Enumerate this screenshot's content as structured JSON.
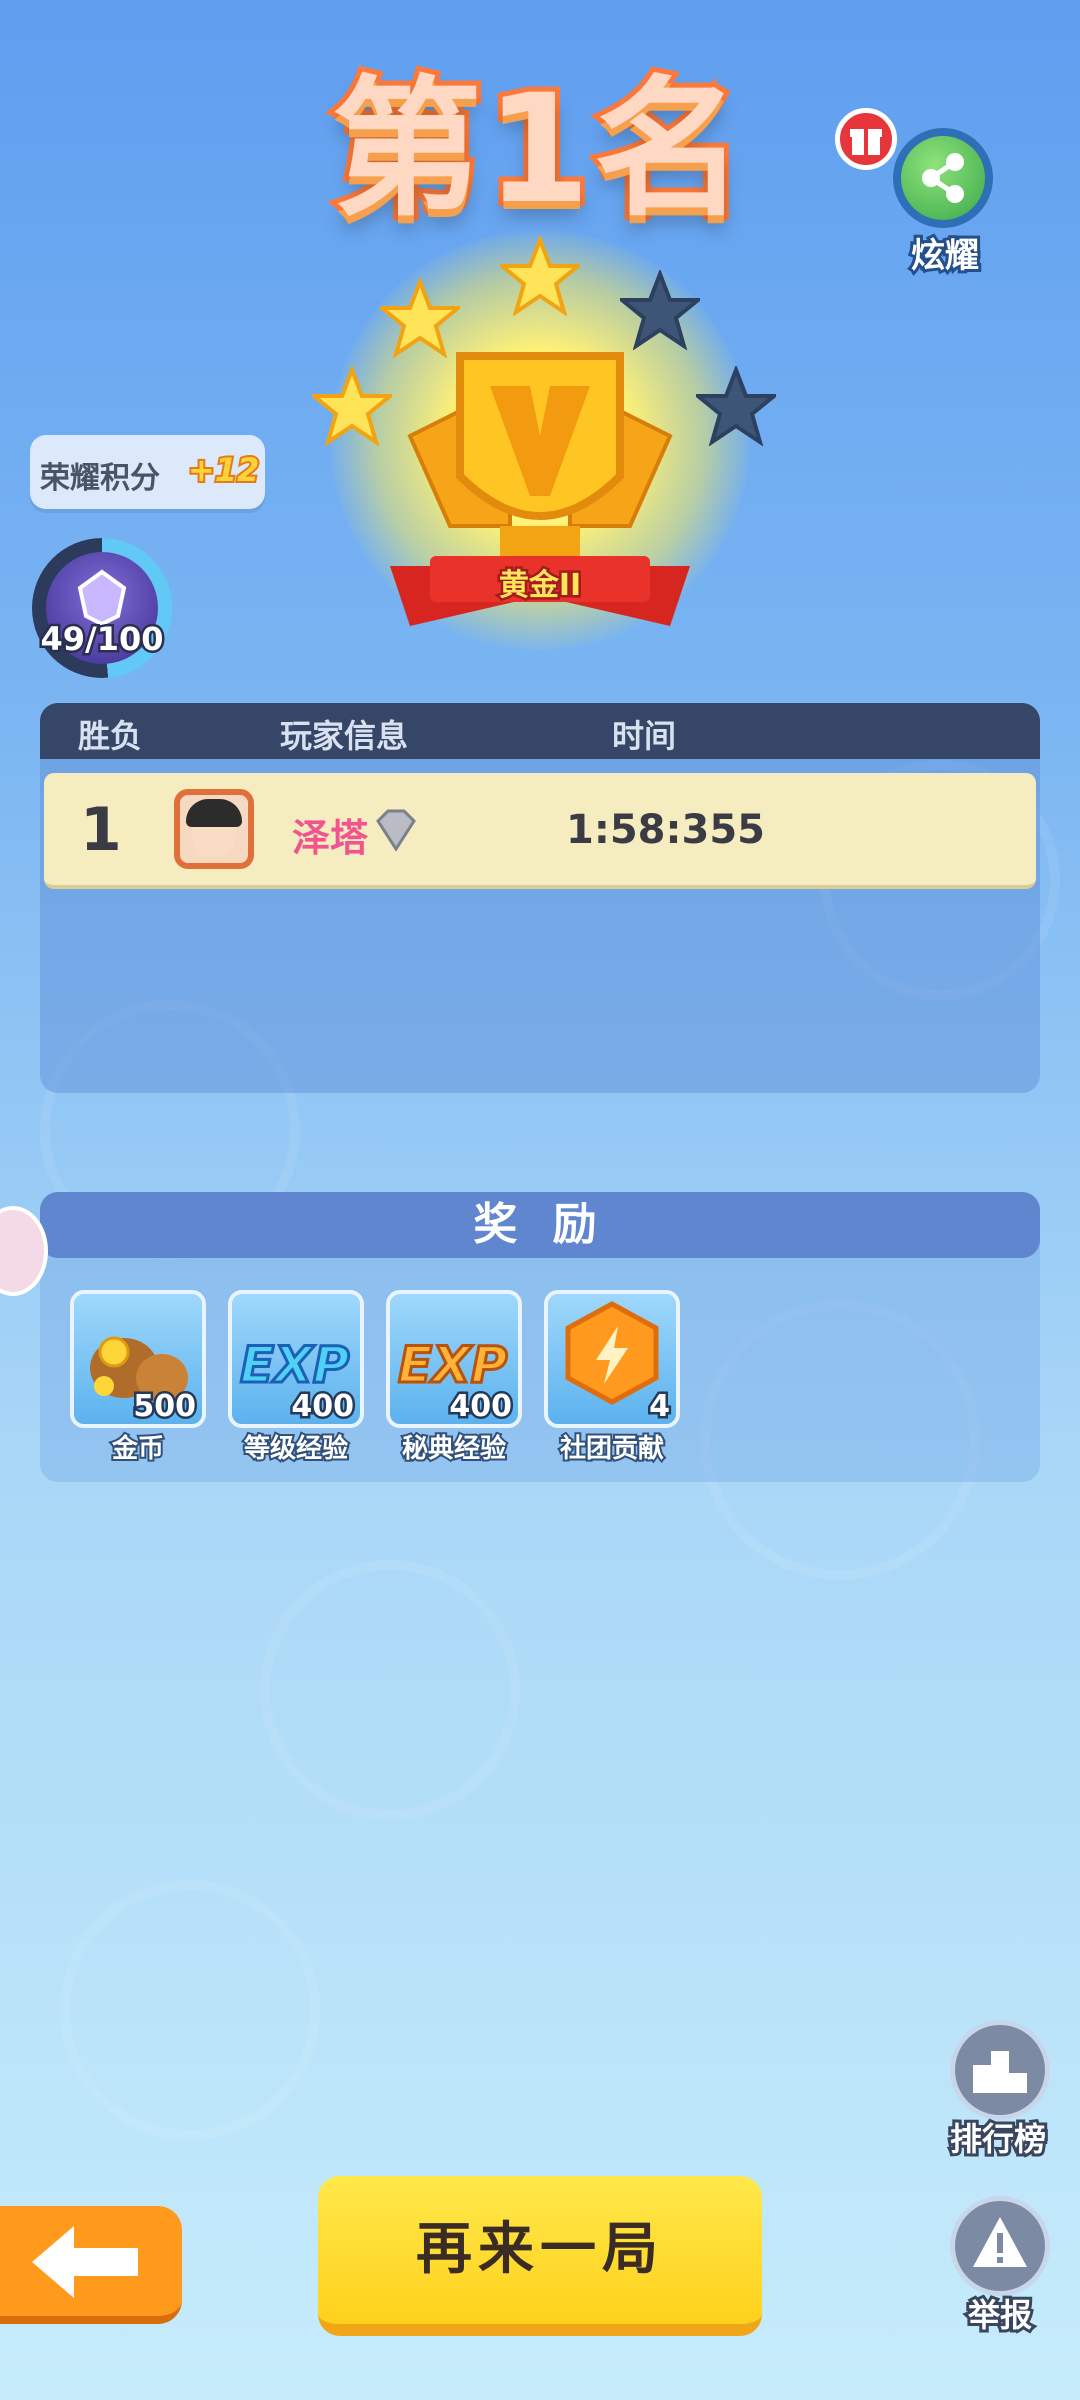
{
  "header": {
    "title": "第1名"
  },
  "share": {
    "label": "炫耀",
    "icon": "share-icon",
    "gift_icon": "gift-icon"
  },
  "trophy": {
    "tier_label": "黄金II",
    "stars_earned": 3,
    "stars_total": 5
  },
  "honor": {
    "label": "荣耀积分",
    "delta": "+12",
    "progress_text": "49/100",
    "progress": 0.49
  },
  "table": {
    "headers": {
      "result": "胜负",
      "player_info": "玩家信息",
      "time": "时间"
    },
    "rows": [
      {
        "rank": "1",
        "name": "泽塔",
        "time": "1:58:355"
      }
    ]
  },
  "rewards": {
    "title": "奖 励",
    "items": [
      {
        "name": "金币",
        "count": "500",
        "icon": "coin-bag-icon"
      },
      {
        "name": "等级经验",
        "count": "400",
        "icon": "exp-icon"
      },
      {
        "name": "秘典经验",
        "count": "400",
        "icon": "exp-icon"
      },
      {
        "name": "社团贡献",
        "count": "4",
        "icon": "lightning-hex-icon"
      }
    ]
  },
  "bottom": {
    "play_again": "再来一局",
    "leaderboard": "排行榜",
    "report": "举报"
  },
  "colors": {
    "accent": "#ffd11c",
    "title_outline": "#ff7a3a",
    "row_highlight": "#f5ecbf",
    "back_button": "#ff9a1d"
  }
}
